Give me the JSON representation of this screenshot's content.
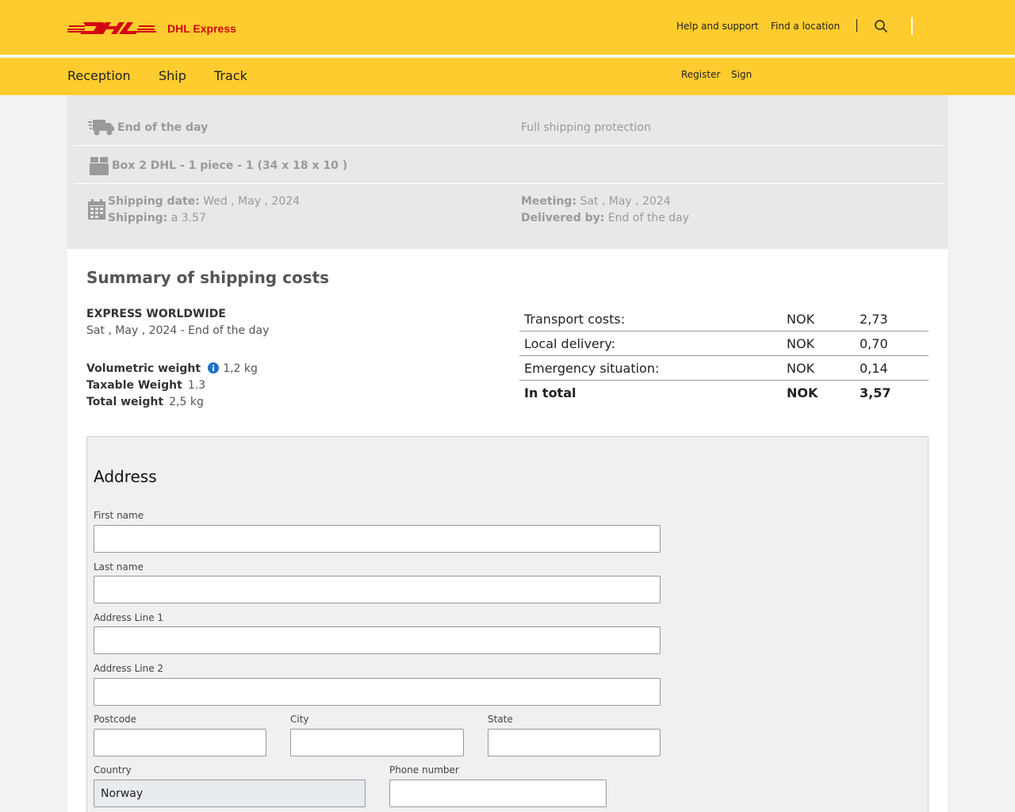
{
  "header": {
    "logo_text": "DHL Express",
    "help_link": "Help and support",
    "location_link": "Find a location",
    "divider": "|"
  },
  "nav": {
    "items": [
      "Reception",
      "Ship",
      "Track"
    ],
    "register": "Register",
    "sign": "Sign"
  },
  "shipment": {
    "delivery_time": "End of the day",
    "protection": "Full shipping protection",
    "package": "Box 2 DHL - 1 piece - 1 (34 x 18 x 10 )",
    "shipping_date_label": "Shipping date:",
    "shipping_date_value": " Wed , May , 2024",
    "shipping_label": "Shipping:",
    "shipping_value": " a 3.57",
    "meeting_label": "Meeting:",
    "meeting_value": " Sat , May , 2024",
    "delivered_label": "Delivered by:",
    "delivered_value": " End of the day"
  },
  "summary": {
    "title": "Summary of shipping costs",
    "service": "EXPRESS WORLDWIDE",
    "service_date": "Sat , May , 2024 - End of the day",
    "volumetric_label": "Volumetric weight",
    "volumetric_value": "1,2 kg",
    "taxable_label": "Taxable Weight",
    "taxable_value": "1.3",
    "total_weight_label": "Total weight",
    "total_weight_value": "2,5 kg",
    "costs": [
      {
        "label": "Transport costs:",
        "currency": "NOK",
        "amount": "2,73"
      },
      {
        "label": "Local delivery:",
        "currency": "NOK",
        "amount": "0,70"
      },
      {
        "label": "Emergency situation:",
        "currency": "NOK",
        "amount": "0,14"
      },
      {
        "label": "In total",
        "currency": "NOK",
        "amount": "3,57"
      }
    ]
  },
  "address": {
    "title": "Address",
    "first_name_label": "First name",
    "first_name_value": "",
    "last_name_label": "Last name",
    "last_name_value": "",
    "line1_label": "Address Line 1",
    "line1_value": "",
    "line2_label": "Address Line 2",
    "line2_value": "",
    "postcode_label": "Postcode",
    "postcode_value": "",
    "city_label": "City",
    "city_value": "",
    "state_label": "State",
    "state_value": "",
    "country_label": "Country",
    "country_value": "Norway",
    "phone_label": "Phone number",
    "phone_value": ""
  },
  "colors": {
    "brand_yellow": "#ffcc2f",
    "brand_red": "#d40511",
    "info_blue": "#1a73c8"
  }
}
